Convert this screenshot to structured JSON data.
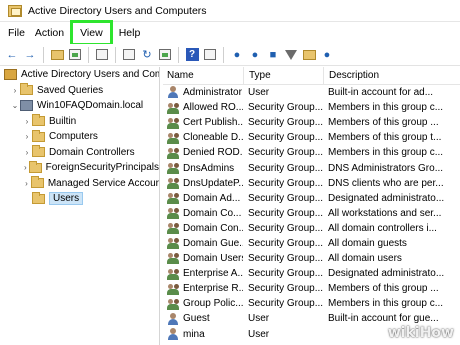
{
  "window": {
    "title": "Active Directory Users and Computers"
  },
  "menu": [
    "File",
    "Action",
    "View",
    "Help"
  ],
  "tree": {
    "root": "Active Directory Users and Com",
    "items": [
      {
        "label": "Saved Queries",
        "level": 1,
        "icon": "folder-icon",
        "chevron": "chevron-right-icon"
      },
      {
        "label": "Win10FAQDomain.local",
        "level": 1,
        "icon": "domain-icon",
        "chevron": "chevron-down-icon"
      },
      {
        "label": "Builtin",
        "level": 2,
        "icon": "folder-icon",
        "chevron": "chevron-right-icon"
      },
      {
        "label": "Computers",
        "level": 2,
        "icon": "folder-icon",
        "chevron": "chevron-right-icon"
      },
      {
        "label": "Domain Controllers",
        "level": 2,
        "icon": "folder-icon",
        "chevron": "chevron-right-icon"
      },
      {
        "label": "ForeignSecurityPrincipals",
        "level": 2,
        "icon": "folder-icon",
        "chevron": "chevron-right-icon"
      },
      {
        "label": "Managed Service Accour",
        "level": 2,
        "icon": "folder-icon",
        "chevron": "chevron-right-icon"
      },
      {
        "label": "Users",
        "level": 2,
        "icon": "folder-icon",
        "chevron": "",
        "selected": true
      }
    ]
  },
  "list": {
    "headers": {
      "name": "Name",
      "type": "Type",
      "description": "Description"
    },
    "rows": [
      {
        "name": "Administrator",
        "type": "User",
        "description": "Built-in account for ad...",
        "icon": "user"
      },
      {
        "name": "Allowed RO...",
        "type": "Security Group...",
        "description": "Members in this group c...",
        "icon": "group"
      },
      {
        "name": "Cert Publish...",
        "type": "Security Group...",
        "description": "Members of this group ...",
        "icon": "group"
      },
      {
        "name": "Cloneable D...",
        "type": "Security Group...",
        "description": "Members of this group t...",
        "icon": "group"
      },
      {
        "name": "Denied ROD...",
        "type": "Security Group...",
        "description": "Members in this group c...",
        "icon": "group"
      },
      {
        "name": "DnsAdmins",
        "type": "Security Group...",
        "description": "DNS Administrators Gro...",
        "icon": "group"
      },
      {
        "name": "DnsUpdateP...",
        "type": "Security Group...",
        "description": "DNS clients who are per...",
        "icon": "group"
      },
      {
        "name": "Domain Ad...",
        "type": "Security Group...",
        "description": "Designated administrato...",
        "icon": "group"
      },
      {
        "name": "Domain Co...",
        "type": "Security Group...",
        "description": "All workstations and ser...",
        "icon": "group"
      },
      {
        "name": "Domain Con...",
        "type": "Security Group...",
        "description": "All domain controllers i...",
        "icon": "group"
      },
      {
        "name": "Domain Gue...",
        "type": "Security Group...",
        "description": "All domain guests",
        "icon": "group"
      },
      {
        "name": "Domain Users",
        "type": "Security Group...",
        "description": "All domain users",
        "icon": "group"
      },
      {
        "name": "Enterprise A...",
        "type": "Security Group...",
        "description": "Designated administrato...",
        "icon": "group"
      },
      {
        "name": "Enterprise R...",
        "type": "Security Group...",
        "description": "Members of this group ...",
        "icon": "group"
      },
      {
        "name": "Group Polic...",
        "type": "Security Group...",
        "description": "Members in this group c...",
        "icon": "group"
      },
      {
        "name": "Guest",
        "type": "User",
        "description": "Built-in account for gue...",
        "icon": "user"
      },
      {
        "name": "mina",
        "type": "User",
        "description": "",
        "icon": "user"
      }
    ]
  },
  "colors": {
    "highlight": "#2ee52e",
    "selection": "#cce4f7"
  },
  "watermark": {
    "wiki": "wiki",
    "how": "How"
  }
}
